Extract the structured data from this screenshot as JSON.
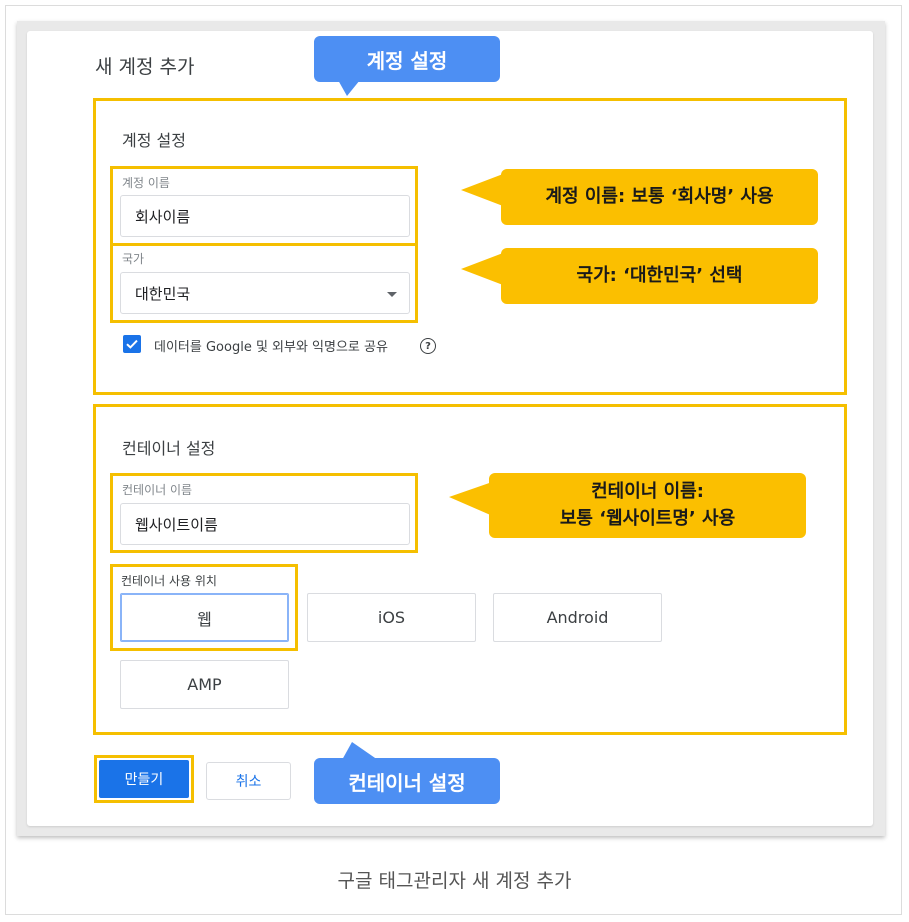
{
  "dialog": {
    "title": "새 계정 추가"
  },
  "account_section": {
    "title": "계정 설정",
    "name_field": {
      "label": "계정 이름",
      "value": "회사이름"
    },
    "country_field": {
      "label": "국가",
      "value": "대한민국"
    },
    "share_checkbox": {
      "checked": true,
      "label": "데이터를 Google 및 외부와 익명으로 공유",
      "help_icon": "help-icon"
    }
  },
  "container_section": {
    "title": "컨테이너 설정",
    "name_field": {
      "label": "컨테이너 이름",
      "value": "웹사이트이름"
    },
    "usage": {
      "label": "컨테이너 사용 위치",
      "options": [
        "웹",
        "iOS",
        "Android",
        "AMP"
      ],
      "selected": "웹"
    }
  },
  "buttons": {
    "create": "만들기",
    "cancel": "취소"
  },
  "callouts": {
    "account_settings": "계정 설정",
    "account_name": "계정 이름: 보통 ‘회사명’ 사용",
    "country": "국가: ‘대한민국’ 선택",
    "container_name_line1": "컨테이너 이름:",
    "container_name_line2": "보통 ‘웹사이트명’ 사용",
    "container_settings": "컨테이너 설정"
  },
  "caption": "구글 태그관리자 새 계정 추가",
  "colors": {
    "highlight": "#f5bf00",
    "callout_yellow": "#fbbf00",
    "callout_blue": "#4d8ff3",
    "primary_button": "#1a73e8"
  }
}
